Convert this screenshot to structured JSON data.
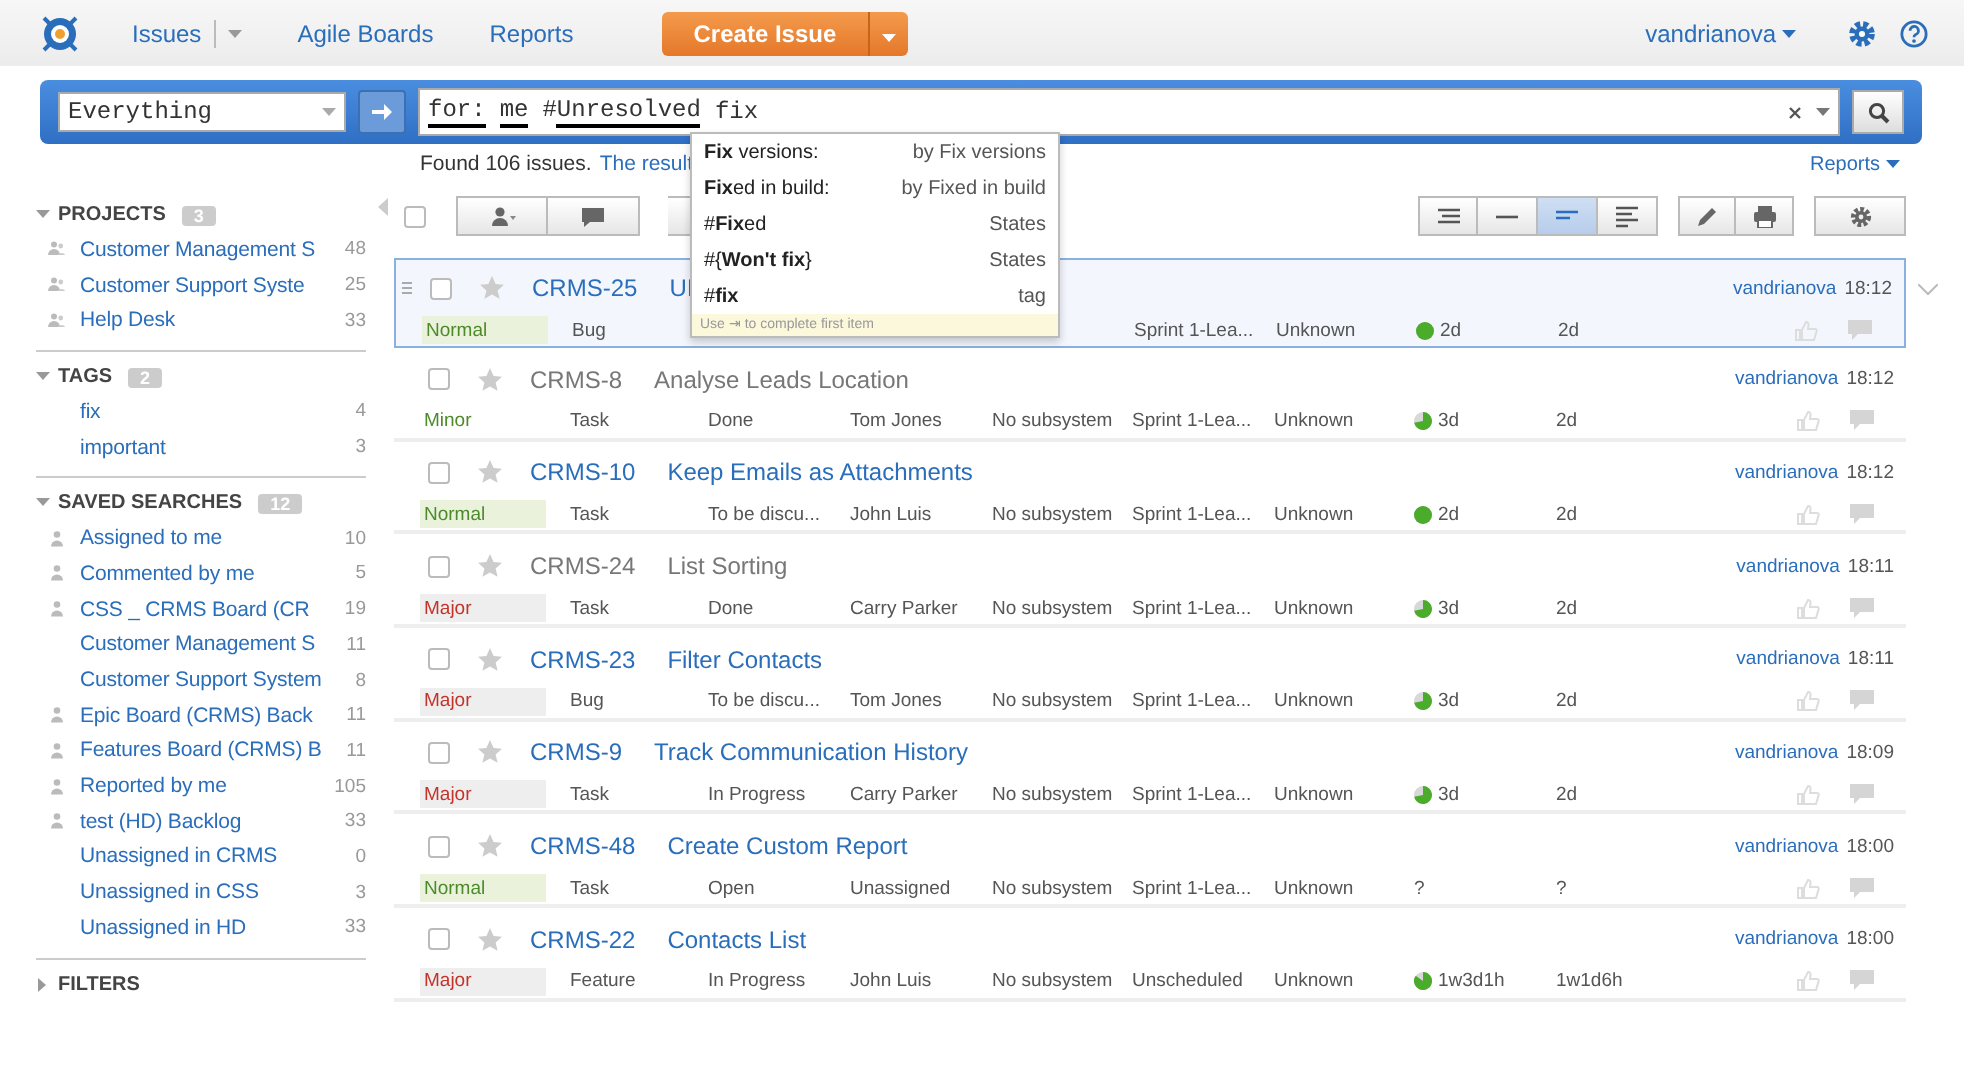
{
  "header": {
    "nav": [
      {
        "label": "Issues",
        "dropdown": true
      },
      {
        "label": "Agile Boards",
        "dropdown": false
      },
      {
        "label": "Reports",
        "dropdown": false
      }
    ],
    "create_button": "Create Issue",
    "user": "vandrianova"
  },
  "search": {
    "context": "Everything",
    "query": [
      {
        "text": "for:",
        "recognized": true
      },
      {
        "text": "me",
        "recognized": true
      },
      {
        "text": "#",
        "recognized": false
      },
      {
        "text": "Unresolved",
        "recognized": true
      },
      {
        "text": "fix",
        "recognized": false
      }
    ]
  },
  "suggestions": {
    "items": [
      {
        "label": "**Fix** versions:",
        "hint": "by Fix versions"
      },
      {
        "label": "**Fix**ed in build:",
        "hint": "by Fixed in build"
      },
      {
        "label": "#**Fix**ed",
        "hint": "States"
      },
      {
        "label": "#{**Won't fix**}",
        "hint": "States"
      },
      {
        "label": "#**fix**",
        "hint": "tag"
      }
    ],
    "footer": "Use ⇥ to complete first item"
  },
  "summary": {
    "found": "Found 106 issues.",
    "link": "The result"
  },
  "reports_link": "Reports",
  "select_all": {
    "checked": false
  },
  "sidebar": [
    {
      "title": "PROJECTS",
      "count": "3",
      "expanded": true,
      "items": [
        {
          "label": "Customer Management S",
          "count": "48",
          "kind": "project"
        },
        {
          "label": "Customer Support Syste",
          "count": "25",
          "kind": "project"
        },
        {
          "label": "Help Desk",
          "count": "33",
          "kind": "project"
        }
      ]
    },
    {
      "title": "TAGS",
      "count": "2",
      "expanded": true,
      "items": [
        {
          "label": "fix",
          "count": "4",
          "kind": "plain"
        },
        {
          "label": "important",
          "count": "3",
          "kind": "plain"
        }
      ]
    },
    {
      "title": "SAVED SEARCHES",
      "count": "12",
      "expanded": true,
      "items": [
        {
          "label": "Assigned to me",
          "count": "10",
          "kind": "personal"
        },
        {
          "label": "Commented by me",
          "count": "5",
          "kind": "personal"
        },
        {
          "label": "CSS _ CRMS Board (CR",
          "count": "19",
          "kind": "personal"
        },
        {
          "label": "Customer Management S",
          "count": "11",
          "kind": "plain"
        },
        {
          "label": "Customer Support System",
          "count": "8",
          "kind": "plain"
        },
        {
          "label": "Epic Board (CRMS) Back",
          "count": "11",
          "kind": "personal"
        },
        {
          "label": "Features Board (CRMS) B",
          "count": "11",
          "kind": "personal"
        },
        {
          "label": "Reported by me",
          "count": "105",
          "kind": "personal"
        },
        {
          "label": "test (HD) Backlog",
          "count": "33",
          "kind": "personal"
        },
        {
          "label": "Unassigned in CRMS",
          "count": "0",
          "kind": "plain"
        },
        {
          "label": "Unassigned in CSS",
          "count": "3",
          "kind": "plain"
        },
        {
          "label": "Unassigned in HD",
          "count": "33",
          "kind": "plain"
        }
      ]
    },
    {
      "title": "FILTERS",
      "expanded": false
    }
  ],
  "view_modes": [
    {
      "selected": false
    },
    {
      "selected": false
    },
    {
      "selected": true
    },
    {
      "selected": false
    }
  ],
  "issues": [
    {
      "id": "CRMS-25",
      "summary": "UI",
      "resolved": false,
      "selected": true,
      "checked": false,
      "priority": {
        "label": "Normal",
        "kind": "normal"
      },
      "type": "Bug",
      "sprint": "Sprint 1-Lea...",
      "fix_version": "Unknown",
      "estimate": "2d",
      "progress": {
        "kind": "full"
      },
      "spent": "2d",
      "author": "vandrianova",
      "time": "18:12"
    },
    {
      "id": "CRMS-8",
      "summary": "Analyse Leads Location",
      "resolved": true,
      "selected": false,
      "checked": false,
      "priority": {
        "label": "Minor",
        "kind": "minor"
      },
      "type": "Task",
      "state": "Done",
      "assignee": "Tom Jones",
      "subsystem": "No subsystem",
      "sprint": "Sprint 1-Lea...",
      "fix_version": "Unknown",
      "estimate": "3d",
      "progress": {
        "kind": "partial"
      },
      "spent": "2d",
      "author": "vandrianova",
      "time": "18:12"
    },
    {
      "id": "CRMS-10",
      "summary": "Keep Emails as Attachments",
      "resolved": false,
      "selected": false,
      "checked": false,
      "priority": {
        "label": "Normal",
        "kind": "normal"
      },
      "type": "Task",
      "state": "To be discu...",
      "assignee": "John Luis",
      "subsystem": "No subsystem",
      "sprint": "Sprint 1-Lea...",
      "fix_version": "Unknown",
      "estimate": "2d",
      "progress": {
        "kind": "full"
      },
      "spent": "2d",
      "author": "vandrianova",
      "time": "18:12"
    },
    {
      "id": "CRMS-24",
      "summary": "List Sorting",
      "resolved": true,
      "selected": false,
      "checked": false,
      "priority": {
        "label": "Major",
        "kind": "major"
      },
      "type": "Task",
      "state": "Done",
      "assignee": "Carry Parker",
      "subsystem": "No subsystem",
      "sprint": "Sprint 1-Lea...",
      "fix_version": "Unknown",
      "estimate": "3d",
      "progress": {
        "kind": "partial"
      },
      "spent": "2d",
      "author": "vandrianova",
      "time": "18:11"
    },
    {
      "id": "CRMS-23",
      "summary": "Filter Contacts",
      "resolved": false,
      "selected": false,
      "checked": false,
      "priority": {
        "label": "Major",
        "kind": "major"
      },
      "type": "Bug",
      "state": "To be discu...",
      "assignee": "Tom Jones",
      "subsystem": "No subsystem",
      "sprint": "Sprint 1-Lea...",
      "fix_version": "Unknown",
      "estimate": "3d",
      "progress": {
        "kind": "partial"
      },
      "spent": "2d",
      "author": "vandrianova",
      "time": "18:11"
    },
    {
      "id": "CRMS-9",
      "summary": "Track Communication History",
      "resolved": false,
      "selected": false,
      "checked": false,
      "priority": {
        "label": "Major",
        "kind": "major"
      },
      "type": "Task",
      "state": "In Progress",
      "assignee": "Carry Parker",
      "subsystem": "No subsystem",
      "sprint": "Sprint 1-Lea...",
      "fix_version": "Unknown",
      "estimate": "3d",
      "progress": {
        "kind": "partial"
      },
      "spent": "2d",
      "author": "vandrianova",
      "time": "18:09"
    },
    {
      "id": "CRMS-48",
      "summary": "Create Custom Report",
      "resolved": false,
      "selected": false,
      "checked": false,
      "priority": {
        "label": "Normal",
        "kind": "normal"
      },
      "type": "Task",
      "state": "Open",
      "assignee": "Unassigned",
      "subsystem": "No subsystem",
      "sprint": "Sprint 1-Lea...",
      "fix_version": "Unknown",
      "estimate": "?",
      "spent": "?",
      "author": "vandrianova",
      "time": "18:00"
    },
    {
      "id": "CRMS-22",
      "summary": "Contacts List",
      "resolved": false,
      "selected": false,
      "checked": false,
      "priority": {
        "label": "Major",
        "kind": "major"
      },
      "type": "Feature",
      "state": "In Progress",
      "assignee": "John Luis",
      "subsystem": "No subsystem",
      "sprint": "Unscheduled",
      "fix_version": "Unknown",
      "estimate": "1w3d1h",
      "progress": {
        "kind": "most"
      },
      "spent": "1w1d6h",
      "author": "vandrianova",
      "time": "18:00"
    }
  ]
}
